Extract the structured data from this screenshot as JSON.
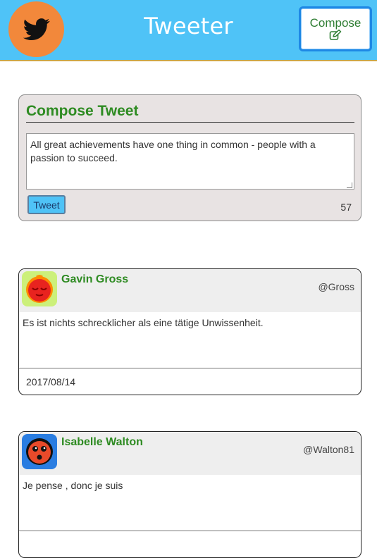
{
  "header": {
    "app_title": "Tweeter",
    "compose_label": "Compose",
    "logo_icon": "twitter-bird-icon",
    "compose_icon": "edit-icon",
    "bar_color": "#4fc3f7",
    "logo_color": "#f2883b"
  },
  "compose": {
    "title": "Compose Tweet",
    "text": "All great achievements have one thing in common - people with a passion to succeed.",
    "button_label": "Tweet",
    "char_count": "57"
  },
  "tweets": [
    {
      "author": "Gavin Gross",
      "handle": "@Gross",
      "text": "Es ist nichts schrecklicher als eine tätige Unwissenheit.",
      "date": "2017/08/14",
      "avatar_icon": "sleepy-face-avatar-icon",
      "avatar_bg": "#ccf07a"
    },
    {
      "author": "Isabelle Walton",
      "handle": "@Walton81",
      "text": "Je pense , donc je suis",
      "date": "",
      "avatar_icon": "surprised-face-avatar-icon",
      "avatar_bg": "#2a7de1"
    }
  ]
}
